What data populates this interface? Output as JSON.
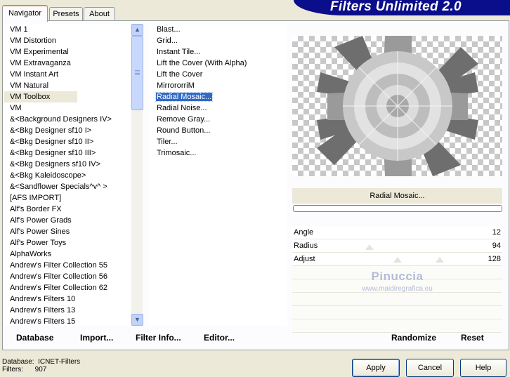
{
  "tabs": [
    {
      "label": "Navigator",
      "active": true
    },
    {
      "label": "Presets",
      "active": false
    },
    {
      "label": "About",
      "active": false
    }
  ],
  "banner_title": "Filters Unlimited 2.0",
  "categories": [
    {
      "label": "VM 1",
      "selected": false
    },
    {
      "label": "VM Distortion",
      "selected": false
    },
    {
      "label": "VM Experimental",
      "selected": false
    },
    {
      "label": "VM Extravaganza",
      "selected": false
    },
    {
      "label": "VM Instant Art",
      "selected": false
    },
    {
      "label": "VM Natural",
      "selected": false
    },
    {
      "label": "VM Toolbox",
      "selected": true
    },
    {
      "label": "VM",
      "selected": false
    },
    {
      "label": "&<Background Designers IV>",
      "selected": false
    },
    {
      "label": "&<Bkg Designer sf10 I>",
      "selected": false
    },
    {
      "label": "&<Bkg Designer sf10 II>",
      "selected": false
    },
    {
      "label": "&<Bkg Designer sf10 III>",
      "selected": false
    },
    {
      "label": "&<Bkg Designers sf10 IV>",
      "selected": false
    },
    {
      "label": "&<Bkg Kaleidoscope>",
      "selected": false
    },
    {
      "label": "&<Sandflower Specials^v^ >",
      "selected": false
    },
    {
      "label": "[AFS IMPORT]",
      "selected": false
    },
    {
      "label": "Alf's Border FX",
      "selected": false
    },
    {
      "label": "Alf's Power Grads",
      "selected": false
    },
    {
      "label": "Alf's Power Sines",
      "selected": false
    },
    {
      "label": "Alf's Power Toys",
      "selected": false
    },
    {
      "label": "AlphaWorks",
      "selected": false
    },
    {
      "label": "Andrew's Filter Collection 55",
      "selected": false
    },
    {
      "label": "Andrew's Filter Collection 56",
      "selected": false
    },
    {
      "label": "Andrew's Filter Collection 62",
      "selected": false
    },
    {
      "label": "Andrew's Filters 10",
      "selected": false
    },
    {
      "label": "Andrew's Filters 13",
      "selected": false
    },
    {
      "label": "Andrew's Filters 15",
      "selected": false
    }
  ],
  "scrollbar": {
    "up_glyph": "▲",
    "down_glyph": "▼"
  },
  "filters": [
    {
      "label": "Blast...",
      "selected": false
    },
    {
      "label": "Grid...",
      "selected": false
    },
    {
      "label": "Instant Tile...",
      "selected": false
    },
    {
      "label": "Lift the Cover (With Alpha)",
      "selected": false
    },
    {
      "label": "Lift the Cover",
      "selected": false
    },
    {
      "label": "MirrororriM",
      "selected": false
    },
    {
      "label": "Radial Mosaic...",
      "selected": true
    },
    {
      "label": "Radial Noise...",
      "selected": false
    },
    {
      "label": "Remove Gray...",
      "selected": false
    },
    {
      "label": "Round Button...",
      "selected": false
    },
    {
      "label": "Tiler...",
      "selected": false
    },
    {
      "label": "Trimosaic...",
      "selected": false
    }
  ],
  "preview": {
    "filter_name": "Radial Mosaic..."
  },
  "params": [
    {
      "label": "Angle",
      "value": "12"
    },
    {
      "label": "Radius",
      "value": "94"
    },
    {
      "label": "Adjust",
      "value": "128"
    }
  ],
  "watermark": {
    "name": "Pinuccia",
    "url": "www.maidiregrafica.eu"
  },
  "bottom_links": {
    "database": "Database",
    "import": "Import...",
    "filter_info": "Filter Info...",
    "editor": "Editor...",
    "randomize": "Randomize",
    "reset": "Reset"
  },
  "status": {
    "database_label": "Database:",
    "database_value": "ICNET-Filters",
    "filters_label": "Filters:",
    "filters_value": "907"
  },
  "buttons": {
    "apply": "Apply",
    "cancel": "Cancel",
    "help": "Help"
  },
  "colors": {
    "banner": "#0b0e8a",
    "selection": "#316ac5",
    "active_tab": "#e68b2c"
  },
  "icons": {
    "scroll_up": "scroll-up-icon",
    "scroll_down": "scroll-down-icon"
  }
}
